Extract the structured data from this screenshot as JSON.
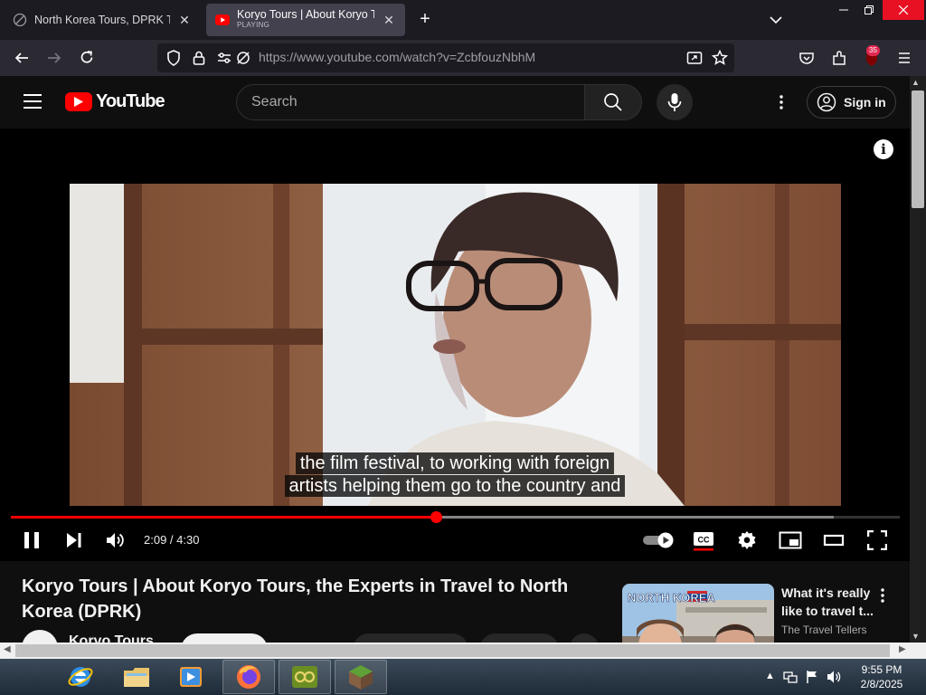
{
  "browser": {
    "tabs": [
      {
        "title": "North Korea Tours, DPRK Travel",
        "active": false,
        "icon": "globe-icon"
      },
      {
        "title": "Koryo Tours | About Koryo Tours",
        "subtitle": "PLAYING",
        "active": true,
        "icon": "youtube-icon"
      }
    ],
    "new_tab": "+",
    "url": "https://www.youtube.com/watch?v=ZcbfouzNbhM",
    "extension_badge": "35"
  },
  "youtube": {
    "logo_text": "YouTube",
    "search_placeholder": "Search",
    "sign_in": "Sign in"
  },
  "player": {
    "captions": [
      "the film festival, to working with foreign",
      "artists helping them go to the country and"
    ],
    "current_time": "2:09",
    "duration": "4:30",
    "time_display": "2:09 / 4:30",
    "progress_fraction": 0.479,
    "buffered_fraction": 0.926,
    "info_label": "i"
  },
  "video": {
    "title": "Koryo Tours | About Koryo Tours, the Experts in Travel to North Korea (DPRK)",
    "channel": "Koryo Tours"
  },
  "recommendation": {
    "title": "What it's really like to travel t...",
    "channel": "The Travel Tellers",
    "thumb_text": "NORTH KOREA"
  },
  "taskbar": {
    "apps": [
      "internet-explorer",
      "file-explorer",
      "media-player",
      "firefox",
      "game-app",
      "minecraft"
    ],
    "time": "9:55 PM",
    "date": "2/8/2025"
  },
  "colors": {
    "accent": "#ff0000",
    "bg": "#0f0f0f",
    "browser_chrome": "#2b2a33"
  }
}
